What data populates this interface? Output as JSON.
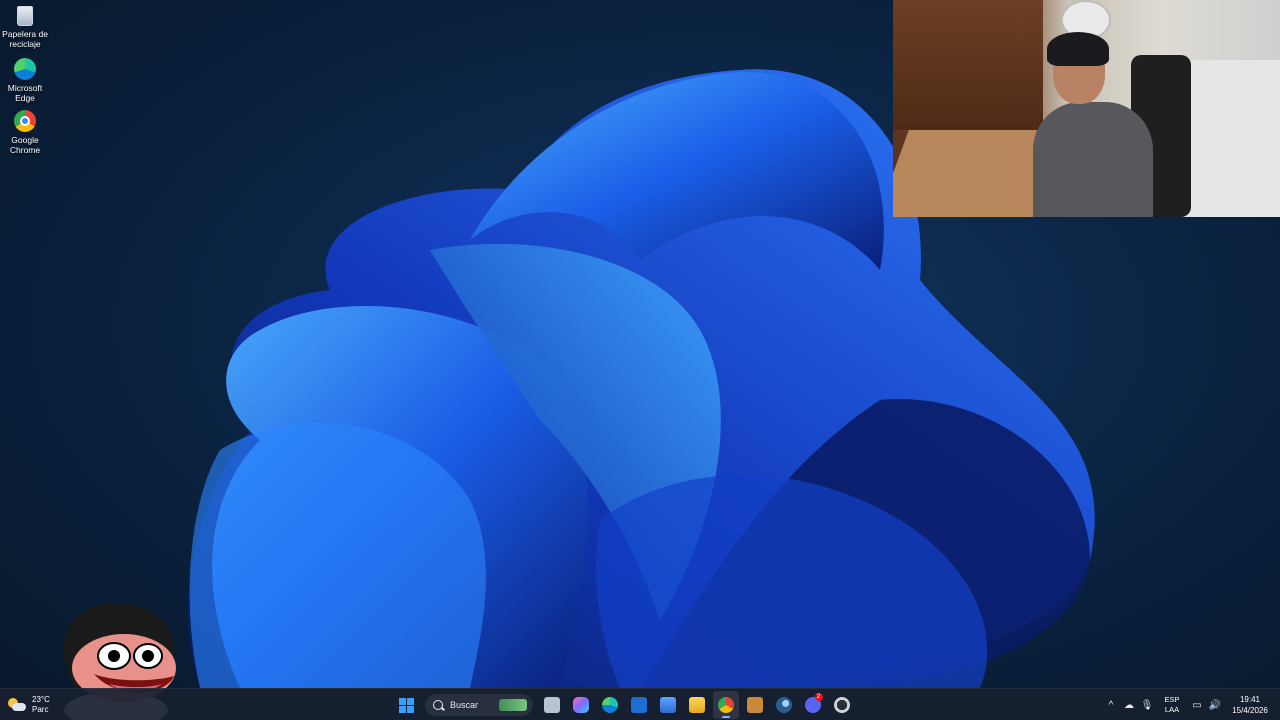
{
  "desktop": {
    "icons": [
      {
        "label": "Papelera de reciclaje",
        "icon": "recycle-bin-icon"
      },
      {
        "label": "Microsoft Edge",
        "icon": "edge-icon"
      },
      {
        "label": "Google Chrome",
        "icon": "chrome-icon"
      }
    ]
  },
  "taskbar": {
    "weather": {
      "temp": "23°C",
      "cond": "Parc",
      "icon": "partly-cloudy-icon"
    },
    "search_placeholder": "Buscar",
    "apps": [
      {
        "name": "task-view-icon",
        "color": "#b9c3d0"
      },
      {
        "name": "copilot-icon",
        "color": "#7b6cff"
      },
      {
        "name": "edge-icon",
        "color": "#1a9fe0"
      },
      {
        "name": "outlook-icon",
        "color": "#1f6ed4"
      },
      {
        "name": "store-icon",
        "color": "#5ca5ff"
      },
      {
        "name": "file-explorer-icon",
        "color": "#f3c334"
      },
      {
        "name": "chrome-icon",
        "color": "#ea4335"
      },
      {
        "name": "game-app-icon",
        "color": "#c98b3a"
      },
      {
        "name": "steam-icon",
        "color": "#4d8ec7"
      },
      {
        "name": "discord-icon",
        "color": "#5865f2"
      },
      {
        "name": "obs-icon",
        "color": "#cfd4da"
      }
    ],
    "discord_badge": "2",
    "tray": {
      "lang_top": "ESP",
      "lang_bottom": "LAA",
      "time": "19:41",
      "date": "15/4/2026"
    }
  },
  "colors": {
    "accent": "#3aa0ff",
    "taskbar": "#182030"
  }
}
